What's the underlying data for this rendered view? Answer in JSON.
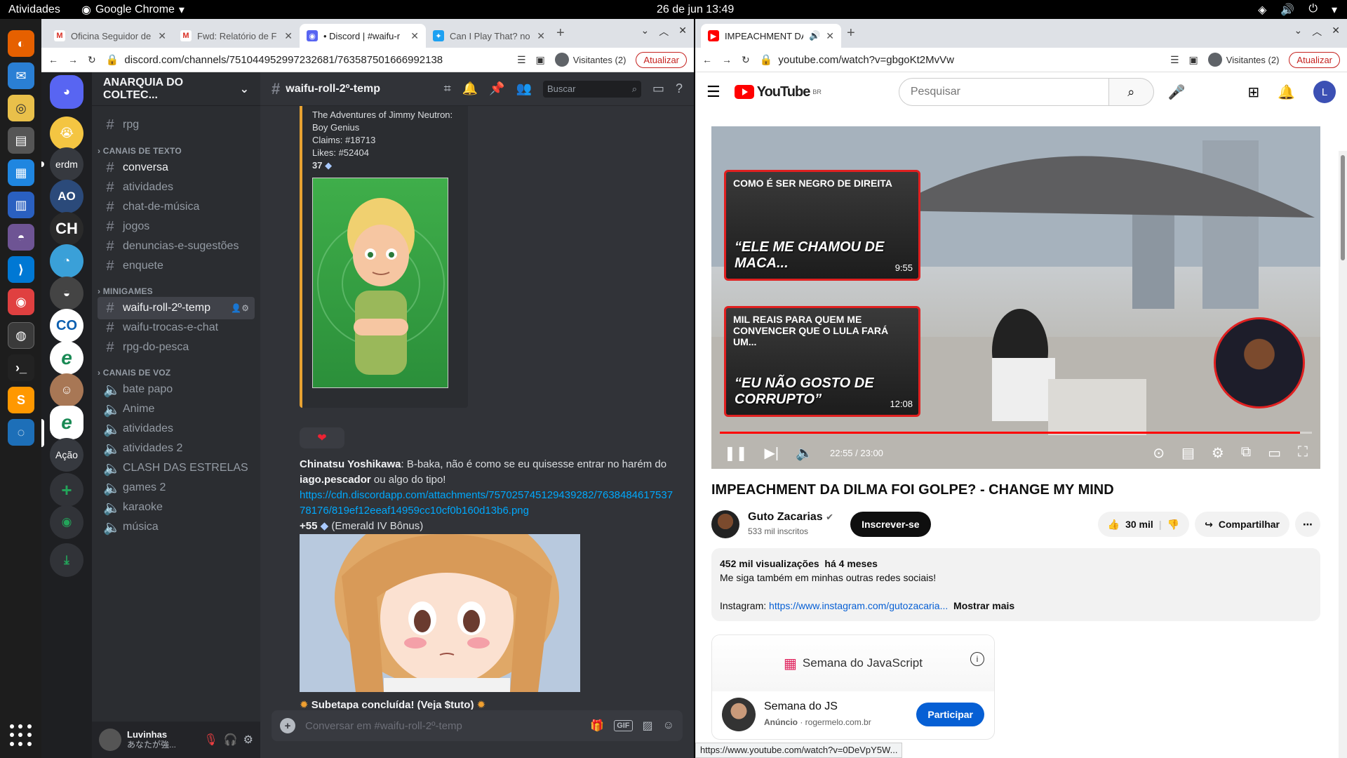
{
  "topbar": {
    "activities": "Atividades",
    "app": "Google Chrome",
    "clock": "26 de jun  13:49"
  },
  "dock": {
    "action_label": "Ação"
  },
  "discord_window": {
    "tabs": [
      {
        "title": "Oficina Seguidor de F",
        "icon": "gmail-icon"
      },
      {
        "title": "Fwd: Relatório de F",
        "icon": "gmail-icon"
      },
      {
        "title": "• Discord | #waifu-r",
        "icon": "discord-icon"
      },
      {
        "title": "Can I Play That? no",
        "icon": "twitter-icon"
      }
    ],
    "url": "discord.com/channels/751044952997232681/763587501666992138",
    "profile": "Visitantes (2)",
    "update": "Atualizar"
  },
  "discord": {
    "servers": [
      "erdm",
      "AO",
      "CH",
      "CO",
      "Ação"
    ],
    "guild_name": "ANARQUIA DO COLTEC...",
    "channel_top": "rpg",
    "cat_text": "CANAIS DE TEXTO",
    "text_channels": [
      "conversa",
      "atividades",
      "chat-de-música",
      "jogos",
      "denuncias-e-sugestões",
      "enquete"
    ],
    "cat_mini": "MINIGAMES",
    "mini_channels": [
      "waifu-roll-2º-temp",
      "waifu-trocas-e-chat",
      "rpg-do-pesca"
    ],
    "cat_voice": "CANAIS DE VOZ",
    "voice_channels": [
      "bate papo",
      "Anime",
      "atividades",
      "atividades 2",
      "CLASH DAS ESTRELAS",
      "games 2",
      "karaoke",
      "música"
    ],
    "user": {
      "name": "Luvinhas",
      "status": "あなたが強..."
    },
    "current_channel": "waifu-roll-2º-temp",
    "search_placeholder": "Buscar",
    "embed": {
      "title": "The Adventures of Jimmy Neutron: Boy Genius",
      "claims": "Claims: #18713",
      "likes": "Likes: #52404",
      "value": "37"
    },
    "message": {
      "author": "Chinatsu Yoshikawa",
      "text_a": ": B-baka, não é como se eu quisesse entrar no harém do ",
      "bold": "iago.pescador",
      "text_b": " ou algo do tipo!",
      "link": "https://cdn.discordapp.com/attachments/757025745129439282/763848461753778176/819ef12eeaf14959cc10cf0b160d13b6.png",
      "bonus_value": "+55",
      "bonus_text": "(Emerald IV Bônus)"
    },
    "tutorial": "Subetapa concluída! (Veja $tuto)",
    "composer_placeholder": "Conversar em #waifu-roll-2º-temp"
  },
  "youtube_window": {
    "tab_title": "IMPEACHMENT DA DILMA",
    "url": "youtube.com/watch?v=gbgoKt2MvVw",
    "profile": "Visitantes (2)",
    "update": "Atualizar"
  },
  "youtube": {
    "logo": "YouTube",
    "region": "BR",
    "search_placeholder": "Pesquisar",
    "avatar_letter": "L",
    "endcards": [
      {
        "title": "COMO É SER NEGRO DE DIREITA",
        "caption": "“ELE ME CHAMOU DE MACA...",
        "duration": "9:55"
      },
      {
        "title": "MIL REAIS PARA QUEM ME CONVENCER QUE O LULA FARÁ UM...",
        "caption": "“EU NÃO GOSTO DE CORRUPTO”",
        "duration": "12:08"
      }
    ],
    "progress": 0.98,
    "time": "22:55 / 23:00",
    "video_title": "IMPEACHMENT DA DILMA FOI GOLPE? - CHANGE MY MIND",
    "channel": "Guto Zacarias",
    "subscribers": "533 mil inscritos",
    "subscribe": "Inscrever-se",
    "likes": "30 mil",
    "share": "Compartilhar",
    "views": "452 mil visualizações",
    "date": "há 4 meses",
    "desc_line": "Me siga também em minhas outras redes sociais!",
    "instagram_label": "Instagram: ",
    "instagram_link": "https://www.instagram.com/gutozacaria...",
    "show_more": "Mostrar mais",
    "ad": {
      "banner": "Semana do JavaScript",
      "title": "Semana do JS",
      "label": "Anúncio",
      "domain": "rogermelo.com.br",
      "cta": "Participar"
    },
    "status_url": "https://www.youtube.com/watch?v=0DeVpY5W..."
  },
  "colors": {
    "discord_bg": "#313338",
    "youtube_red": "#ff0000",
    "accent_blue": "#065fd4"
  }
}
